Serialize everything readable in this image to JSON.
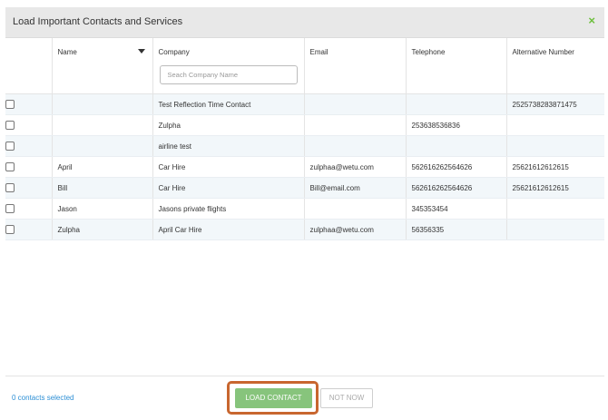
{
  "dialog": {
    "title": "Load Important Contacts and Services",
    "close_icon": "×"
  },
  "table": {
    "columns": [
      "Name",
      "Company",
      "Email",
      "Telephone",
      "Alternative Number"
    ],
    "search_placeholder": "Seach Company Name",
    "rows": [
      {
        "name": "",
        "company": "Test Reflection Time Contact",
        "email": "",
        "telephone": "",
        "alternative": "2525738283871475"
      },
      {
        "name": "",
        "company": "Zulpha",
        "email": "",
        "telephone": "253638536836",
        "alternative": ""
      },
      {
        "name": "",
        "company": "airline test",
        "email": "",
        "telephone": "",
        "alternative": ""
      },
      {
        "name": "April",
        "company": "Car Hire",
        "email": "zulphaa@wetu.com",
        "telephone": "562616262564626",
        "alternative": "25621612612615"
      },
      {
        "name": "Bill",
        "company": "Car Hire",
        "email": "Bill@email.com",
        "telephone": "562616262564626",
        "alternative": "25621612612615"
      },
      {
        "name": "Jason",
        "company": "Jasons private flights",
        "email": "",
        "telephone": "345353454",
        "alternative": ""
      },
      {
        "name": "Zulpha",
        "company": "April Car Hire",
        "email": "zulphaa@wetu.com",
        "telephone": "56356335",
        "alternative": ""
      }
    ]
  },
  "footer": {
    "selected_text": "0 contacts selected",
    "load_button": "LOAD CONTACT",
    "not_now_button": "NOT NOW"
  },
  "colors": {
    "accent_green": "#87c47c",
    "link_blue": "#2d8fd5",
    "highlight_orange": "#c8662f"
  }
}
